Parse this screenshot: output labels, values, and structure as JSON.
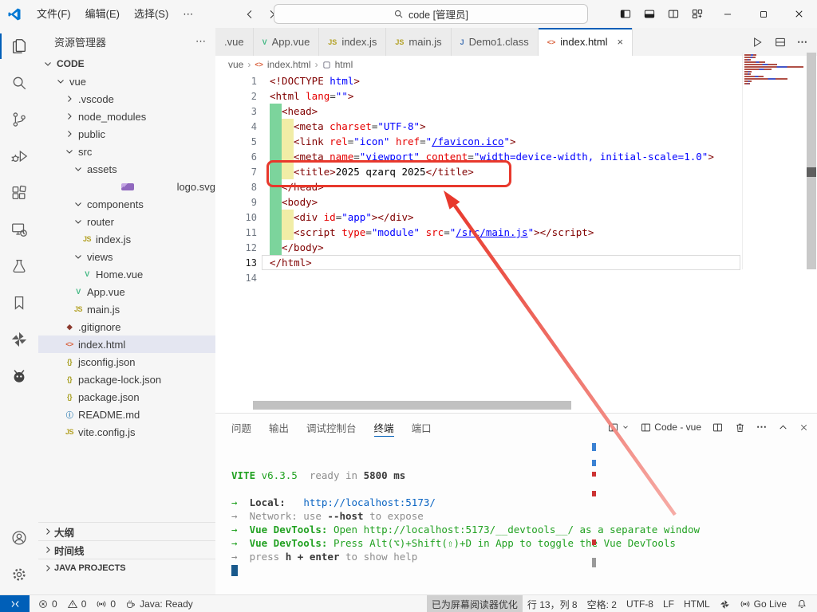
{
  "titlebar": {
    "menus": [
      "文件(F)",
      "编辑(E)",
      "选择(S)",
      "⋯"
    ],
    "search_text": "code [管理员]"
  },
  "activity_bar": {
    "items": [
      {
        "name": "explorer",
        "active": true
      },
      {
        "name": "search"
      },
      {
        "name": "source-control"
      },
      {
        "name": "run-debug"
      },
      {
        "name": "extensions"
      },
      {
        "name": "remote-explorer"
      },
      {
        "name": "testing"
      },
      {
        "name": "bookmarks"
      },
      {
        "name": "pinwheel-extension"
      },
      {
        "name": "bee-extension"
      }
    ],
    "bottom": [
      {
        "name": "account"
      },
      {
        "name": "settings"
      }
    ]
  },
  "sidebar": {
    "title": "资源管理器",
    "more": "⋯",
    "tree": [
      {
        "label": "CODE",
        "level": 0,
        "chev": "down",
        "bold": true
      },
      {
        "label": "vue",
        "level": 1,
        "chev": "down"
      },
      {
        "label": ".vscode",
        "level": 2,
        "chev": "right"
      },
      {
        "label": "node_modules",
        "level": 2,
        "chev": "right"
      },
      {
        "label": "public",
        "level": 2,
        "chev": "right"
      },
      {
        "label": "src",
        "level": 2,
        "chev": "down"
      },
      {
        "label": "assets",
        "level": 3,
        "chev": "down"
      },
      {
        "label": "logo.svg",
        "level": 4,
        "icon": "svgimg"
      },
      {
        "label": "components",
        "level": 3,
        "chev": "down"
      },
      {
        "label": "router",
        "level": 3,
        "chev": "down"
      },
      {
        "label": "index.js",
        "level": 4,
        "icon": "js"
      },
      {
        "label": "views",
        "level": 3,
        "chev": "down"
      },
      {
        "label": "Home.vue",
        "level": 4,
        "icon": "vue"
      },
      {
        "label": "App.vue",
        "level": 3,
        "icon": "vue"
      },
      {
        "label": "main.js",
        "level": 3,
        "icon": "js"
      },
      {
        "label": ".gitignore",
        "level": 2,
        "icon": "git"
      },
      {
        "label": "index.html",
        "level": 2,
        "icon": "html",
        "selected": true
      },
      {
        "label": "jsconfig.json",
        "level": 2,
        "icon": "json"
      },
      {
        "label": "package-lock.json",
        "level": 2,
        "icon": "json"
      },
      {
        "label": "package.json",
        "level": 2,
        "icon": "json"
      },
      {
        "label": "README.md",
        "level": 2,
        "icon": "info"
      },
      {
        "label": "vite.config.js",
        "level": 2,
        "icon": "js"
      }
    ],
    "bottom_sections": [
      {
        "label": "大纲",
        "caps": false
      },
      {
        "label": "时间线",
        "caps": false
      },
      {
        "label": "JAVA PROJECTS",
        "caps": true
      }
    ]
  },
  "editor": {
    "tabs": [
      {
        "label": ".vue"
      },
      {
        "label": "App.vue",
        "icon": "vue"
      },
      {
        "label": "index.js",
        "icon": "js"
      },
      {
        "label": "main.js",
        "icon": "js"
      },
      {
        "label": "Demo1.class",
        "icon": "java"
      },
      {
        "label": "index.html",
        "icon": "html",
        "active": true
      }
    ],
    "breadcrumb": [
      "vue",
      "index.html",
      "html"
    ],
    "lines": [
      {
        "n": 1,
        "ind": 0,
        "tk": [
          [
            "tag",
            "<!DOCTYPE "
          ],
          [
            "val",
            "html"
          ],
          [
            "tag",
            ">"
          ]
        ]
      },
      {
        "n": 2,
        "ind": 0,
        "tk": [
          [
            "tag",
            "<html "
          ],
          [
            "attr",
            "lang"
          ],
          [
            "op",
            "="
          ],
          [
            "val",
            "\"\""
          ],
          [
            "tag",
            ">"
          ]
        ]
      },
      {
        "n": 3,
        "ind": 1,
        "tk": [
          [
            "tag",
            "<head>"
          ]
        ]
      },
      {
        "n": 4,
        "ind": 2,
        "tk": [
          [
            "tag",
            "<meta "
          ],
          [
            "attr",
            "charset"
          ],
          [
            "op",
            "="
          ],
          [
            "val",
            "\"UTF-8\""
          ],
          [
            "tag",
            ">"
          ]
        ]
      },
      {
        "n": 5,
        "ind": 2,
        "tk": [
          [
            "tag",
            "<link "
          ],
          [
            "attr",
            "rel"
          ],
          [
            "op",
            "="
          ],
          [
            "val",
            "\"icon\""
          ],
          [
            "attr",
            " href"
          ],
          [
            "op",
            "="
          ],
          [
            "val",
            "\""
          ],
          [
            "link",
            "/favicon.ico"
          ],
          [
            "val",
            "\""
          ],
          [
            "tag",
            ">"
          ]
        ]
      },
      {
        "n": 6,
        "ind": 2,
        "tk": [
          [
            "tag",
            "<meta "
          ],
          [
            "attr",
            "name"
          ],
          [
            "op",
            "="
          ],
          [
            "val",
            "\"viewport\""
          ],
          [
            "attr",
            " content"
          ],
          [
            "op",
            "="
          ],
          [
            "val",
            "\"width=device-width, initial-scale=1.0\""
          ],
          [
            "tag",
            ">"
          ]
        ]
      },
      {
        "n": 7,
        "ind": 2,
        "tk": [
          [
            "tag",
            "<title>"
          ],
          [
            "txt",
            "2025 qzarq 2025"
          ],
          [
            "tag",
            "</title>"
          ]
        ]
      },
      {
        "n": 8,
        "ind": 1,
        "tk": [
          [
            "tag",
            "</head>"
          ]
        ]
      },
      {
        "n": 9,
        "ind": 1,
        "tk": [
          [
            "tag",
            "<body>"
          ]
        ]
      },
      {
        "n": 10,
        "ind": 2,
        "tk": [
          [
            "tag",
            "<div "
          ],
          [
            "attr",
            "id"
          ],
          [
            "op",
            "="
          ],
          [
            "val",
            "\"app\""
          ],
          [
            "tag",
            "></div>"
          ]
        ]
      },
      {
        "n": 11,
        "ind": 2,
        "tk": [
          [
            "tag",
            "<script "
          ],
          [
            "attr",
            "type"
          ],
          [
            "op",
            "="
          ],
          [
            "val",
            "\"module\""
          ],
          [
            "attr",
            " src"
          ],
          [
            "op",
            "="
          ],
          [
            "val",
            "\""
          ],
          [
            "link",
            "/src/main.js"
          ],
          [
            "val",
            "\""
          ],
          [
            "tag",
            "></script>"
          ]
        ]
      },
      {
        "n": 12,
        "ind": 1,
        "tk": [
          [
            "tag",
            "</body>"
          ]
        ]
      },
      {
        "n": 13,
        "ind": 0,
        "tk": [
          [
            "tag",
            "</html>"
          ]
        ],
        "current": true
      },
      {
        "n": 14,
        "ind": 0,
        "tk": []
      }
    ]
  },
  "panel": {
    "tabs": [
      {
        "label": "问题"
      },
      {
        "label": "输出"
      },
      {
        "label": "调试控制台"
      },
      {
        "label": "终端",
        "active": true
      },
      {
        "label": "端口"
      }
    ],
    "terminal_title": "Code - vue",
    "terminal": [
      [],
      [
        [
          "grnB",
          "VITE"
        ],
        [
          "grn",
          " v6.3.5"
        ],
        [
          "gry",
          "  ready in "
        ],
        [
          "blkB",
          "5800 ms"
        ]
      ],
      [],
      [
        [
          "grn",
          "→"
        ],
        [
          "blkB",
          "  Local:"
        ],
        [
          "pln",
          "   "
        ],
        [
          "url",
          "http://localhost:5173/"
        ]
      ],
      [
        [
          "gry",
          "→  Network: use "
        ],
        [
          "blkB",
          "--host"
        ],
        [
          "gry",
          " to expose"
        ]
      ],
      [
        [
          "grn",
          "→  "
        ],
        [
          "grnB",
          "Vue DevTools:"
        ],
        [
          "grn",
          " Open http://localhost:5173/__devtools__/ as a separate window"
        ]
      ],
      [
        [
          "grn",
          "→  "
        ],
        [
          "grnB",
          "Vue DevTools:"
        ],
        [
          "grn",
          " Press Alt(⌥)+Shift(⇧)+D in App to toggle the Vue DevTools"
        ]
      ],
      [
        [
          "gry",
          "→  press "
        ],
        [
          "blkB",
          "h + enter"
        ],
        [
          "gry",
          " to show help"
        ]
      ],
      [
        [
          "cursor",
          ""
        ]
      ]
    ]
  },
  "statusbar": {
    "left": [
      {
        "icon": "error",
        "label": "0"
      },
      {
        "icon": "warning",
        "label": "0"
      },
      {
        "icon": "ports",
        "label": "0"
      },
      {
        "icon": "java",
        "label": "Java: Ready"
      }
    ],
    "right": [
      {
        "label": "已为屏幕阅读器优化",
        "badge": true
      },
      {
        "label": "行 13，列 8"
      },
      {
        "label": "空格: 2"
      },
      {
        "label": "UTF-8"
      },
      {
        "label": "LF"
      },
      {
        "label": "HTML"
      },
      {
        "icon": "pinwheel"
      },
      {
        "icon": "broadcast",
        "label": "Go Live"
      },
      {
        "icon": "bell"
      }
    ]
  },
  "colors": {
    "accent": "#005fb8",
    "annotation": "#e8382c"
  }
}
